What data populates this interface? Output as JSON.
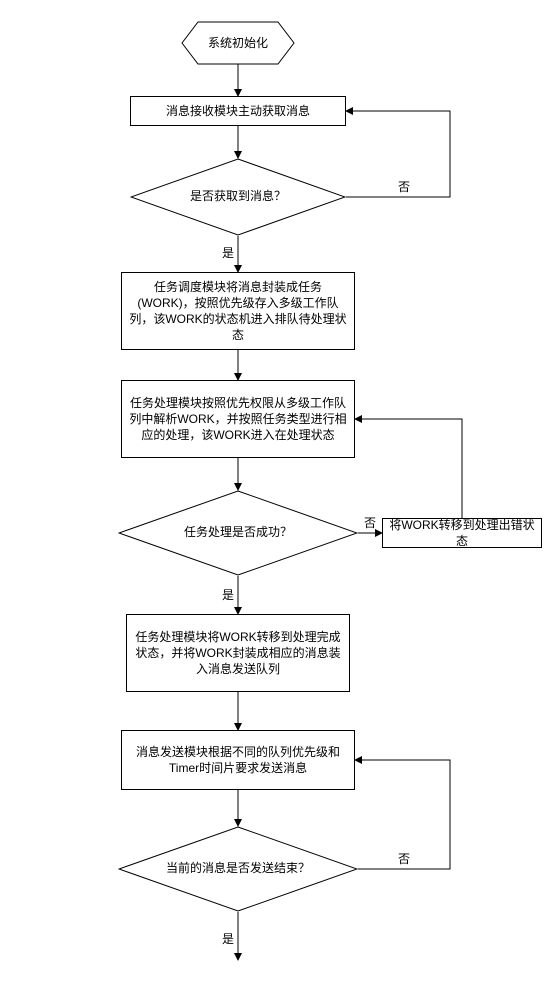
{
  "start": "系统初始化",
  "box1": "消息接收模块主动获取消息",
  "dec1": "是否获取到消息？",
  "box2": "任务调度模块将消息封装成任务(WORK)，按照优先级存入多级工作队列，该WORK的状态机进入排队待处理状态",
  "box3": "任务处理模块按照优先权限从多级工作队列中解析WORK，并按照任务类型进行相应的处理，该WORK进入在处理状态",
  "dec2": "任务处理是否成功？",
  "box_err": "将WORK转移到处理出错状态",
  "box4": "任务处理模块将WORK转移到处理完成状态，并将WORK封装成相应的消息装入消息发送队列",
  "box5": "消息发送模块根据不同的队列优先级和Timer时间片要求发送消息",
  "dec3": "当前的消息是否发送结束？",
  "yes": "是",
  "no": "否"
}
